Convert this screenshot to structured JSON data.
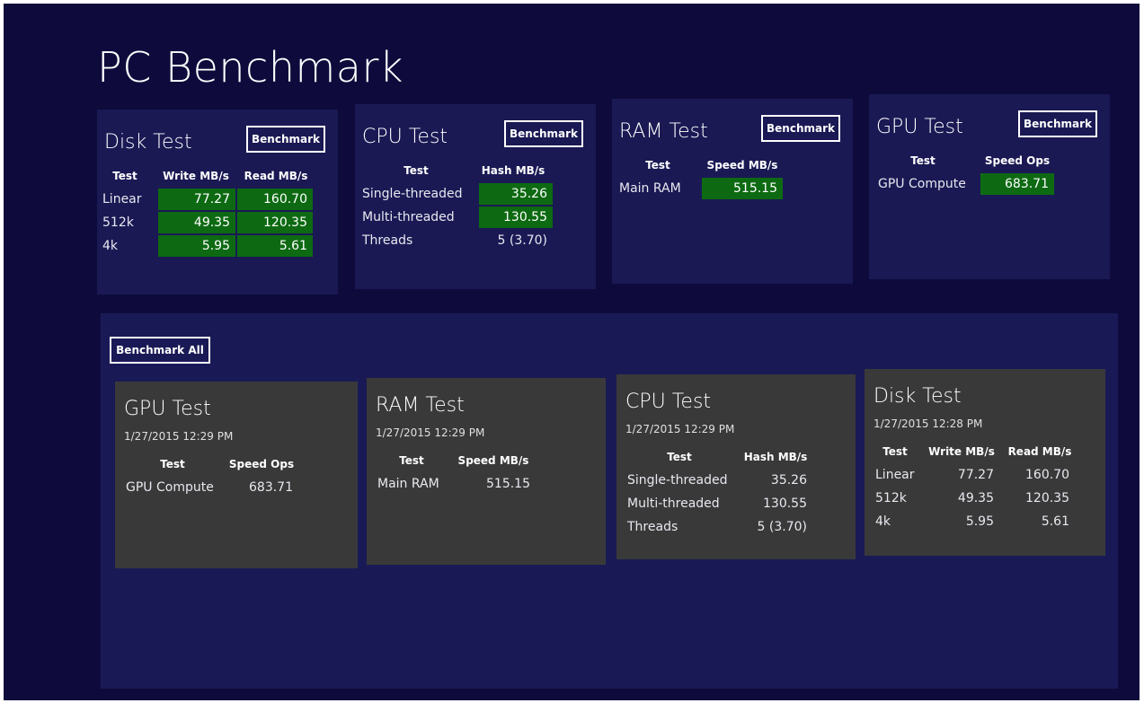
{
  "app": {
    "title": "PC Benchmark"
  },
  "colors": {
    "background": "#0e0b3c",
    "tile": "#1a1954",
    "result_tile": "#393939",
    "highlight": "#0d6a12"
  },
  "tiles": {
    "disk": {
      "title": "Disk Test",
      "button": "Benchmark",
      "headers": [
        "Test",
        "Write MB/s",
        "Read MB/s"
      ],
      "rows": [
        [
          "Linear",
          "77.27",
          "160.70"
        ],
        [
          "512k",
          "49.35",
          "120.35"
        ],
        [
          "4k",
          "5.95",
          "5.61"
        ]
      ]
    },
    "cpu": {
      "title": "CPU Test",
      "button": "Benchmark",
      "headers": [
        "Test",
        "Hash MB/s"
      ],
      "rows": [
        [
          "Single-threaded",
          "35.26"
        ],
        [
          "Multi-threaded",
          "130.55"
        ],
        [
          "Threads",
          "5 (3.70)"
        ]
      ]
    },
    "ram": {
      "title": "RAM Test",
      "button": "Benchmark",
      "headers": [
        "Test",
        "Speed MB/s"
      ],
      "rows": [
        [
          "Main RAM",
          "515.15"
        ]
      ]
    },
    "gpu": {
      "title": "GPU Test",
      "button": "Benchmark",
      "headers": [
        "Test",
        "Speed Ops"
      ],
      "rows": [
        [
          "GPU Compute",
          "683.71"
        ]
      ]
    }
  },
  "results": {
    "button": "Benchmark All",
    "gpu": {
      "title": "GPU Test",
      "timestamp": "1/27/2015 12:29 PM",
      "headers": [
        "Test",
        "Speed Ops"
      ],
      "rows": [
        [
          "GPU Compute",
          "683.71"
        ]
      ]
    },
    "ram": {
      "title": "RAM Test",
      "timestamp": "1/27/2015 12:29 PM",
      "headers": [
        "Test",
        "Speed MB/s"
      ],
      "rows": [
        [
          "Main RAM",
          "515.15"
        ]
      ]
    },
    "cpu": {
      "title": "CPU Test",
      "timestamp": "1/27/2015 12:29 PM",
      "headers": [
        "Test",
        "Hash MB/s"
      ],
      "rows": [
        [
          "Single-threaded",
          "35.26"
        ],
        [
          "Multi-threaded",
          "130.55"
        ],
        [
          "Threads",
          "5 (3.70)"
        ]
      ]
    },
    "disk": {
      "title": "Disk Test",
      "timestamp": "1/27/2015 12:28 PM",
      "headers": [
        "Test",
        "Write MB/s",
        "Read MB/s"
      ],
      "rows": [
        [
          "Linear",
          "77.27",
          "160.70"
        ],
        [
          "512k",
          "49.35",
          "120.35"
        ],
        [
          "4k",
          "5.95",
          "5.61"
        ]
      ]
    }
  }
}
